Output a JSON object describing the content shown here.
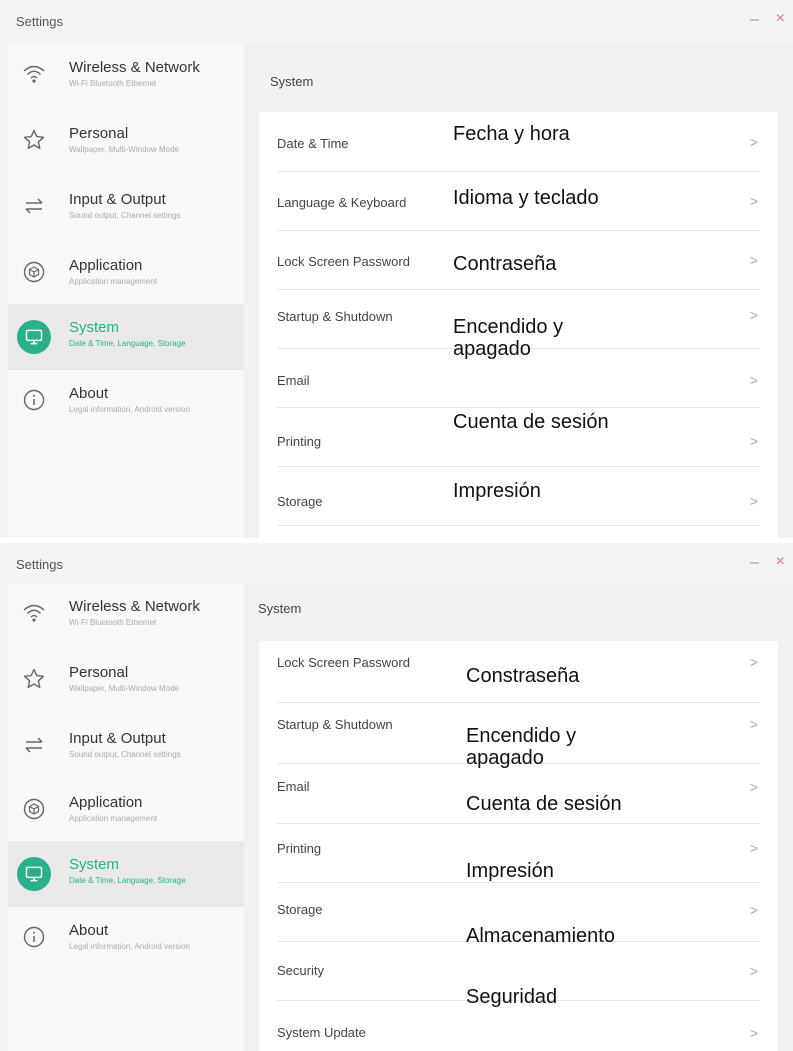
{
  "accent_color": "#28b08a",
  "window": {
    "title": "Settings",
    "minimize_glyph": "–",
    "close_glyph": "×"
  },
  "sidebar": {
    "items": [
      {
        "label": "Wireless & Network",
        "sub": "Wi-Fi Bluetooth Ethernet",
        "icon": "wifi-icon"
      },
      {
        "label": "Personal",
        "sub": "Wallpaper, Multi-Window Mode",
        "icon": "star-icon"
      },
      {
        "label": "Input & Output",
        "sub": "Sound output, Channel settings",
        "icon": "swap-arrows-icon"
      },
      {
        "label": "Application",
        "sub": "Application management",
        "icon": "cube-icon"
      },
      {
        "label": "System",
        "sub": "Date & Time, Language, Storage",
        "icon": "monitor-icon",
        "active": true
      },
      {
        "label": "About",
        "sub": "Legal information, Android version",
        "icon": "info-icon"
      }
    ]
  },
  "screen1": {
    "section_title": "System",
    "rows": [
      {
        "label": "Date & Time"
      },
      {
        "label": "Language & Keyboard"
      },
      {
        "label": "Lock Screen Password"
      },
      {
        "label": "Startup & Shutdown"
      },
      {
        "label": "Email"
      },
      {
        "label": "Printing"
      },
      {
        "label": "Storage"
      }
    ],
    "overlays": [
      {
        "text": "Fecha y hora"
      },
      {
        "text": "Idioma y teclado"
      },
      {
        "text": "Contraseña"
      },
      {
        "line1": "Encendido y",
        "line2": "apagado"
      },
      {
        "text": "Cuenta de sesión"
      },
      {
        "text": "Impresión"
      }
    ]
  },
  "screen2": {
    "section_title": "System",
    "rows": [
      {
        "label": "Lock Screen Password"
      },
      {
        "label": "Startup & Shutdown"
      },
      {
        "label": "Email"
      },
      {
        "label": "Printing"
      },
      {
        "label": "Storage"
      },
      {
        "label": "Security"
      },
      {
        "label": "System Update"
      }
    ],
    "overlays": [
      {
        "text": "Constraseña"
      },
      {
        "line1": "Encendido y",
        "line2": "apagado"
      },
      {
        "text": "Cuenta de sesión"
      },
      {
        "text": "Impresión"
      },
      {
        "text": "Almacenamiento"
      },
      {
        "text": "Seguridad"
      }
    ]
  },
  "chevron_glyph": ">"
}
